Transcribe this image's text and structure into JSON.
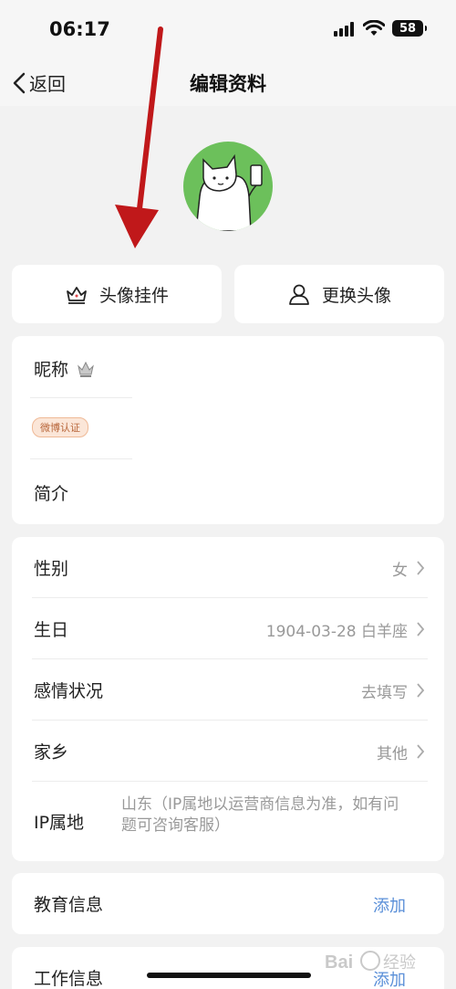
{
  "status_bar": {
    "time": "06:17",
    "battery": "58"
  },
  "nav": {
    "back_label": "返回",
    "title": "编辑资料"
  },
  "actions": {
    "pendant_label": "头像挂件",
    "change_avatar_label": "更换头像"
  },
  "profile": {
    "nickname_label": "昵称",
    "weibo_badge": "微博认证",
    "intro_label": "简介"
  },
  "basic_info": [
    {
      "label": "性别",
      "value": "女"
    },
    {
      "label": "生日",
      "value": "1904-03-28 白羊座"
    },
    {
      "label": "感情状况",
      "value": "去填写"
    },
    {
      "label": "家乡",
      "value": "其他"
    }
  ],
  "ip": {
    "label": "IP属地",
    "value": "山东（IP属地以运营商信息为准，如有问题可咨询客服）"
  },
  "education": {
    "label": "教育信息",
    "action": "添加"
  },
  "work": {
    "label": "工作信息",
    "action": "添加"
  },
  "colors": {
    "accent": "#5a8fd8",
    "badge_text": "#b8663a",
    "badge_bg": "#fbe6d8",
    "arrow": "#c0181a",
    "avatar_bg": "#6cc05b"
  },
  "watermark": "Bai经验"
}
